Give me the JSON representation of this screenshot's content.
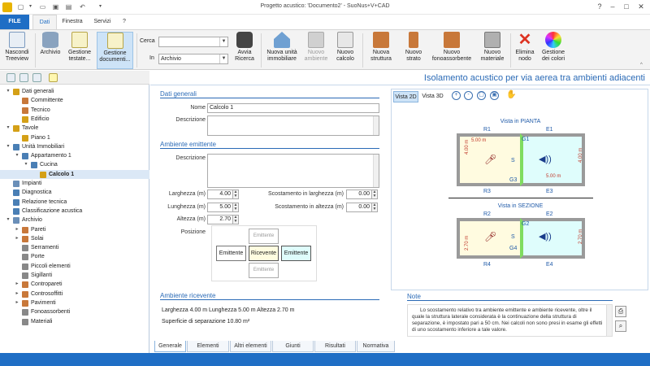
{
  "app": {
    "title": "Progetto acustico: 'Documento2' - SuoNus+V+CAD"
  },
  "tabs": {
    "file": "FILE",
    "items": [
      "Dati",
      "Finestra",
      "Servizi",
      "?"
    ]
  },
  "ribbon": {
    "nascondi": "Nascondi Treeview",
    "archivio": "Archivio",
    "gestione_testate": "Gestione testate...",
    "gestione_documenti": "Gestione documenti...",
    "cerca_label": "Cerca",
    "cerca_value": "",
    "in_label": "In",
    "in_value": "Archivio",
    "avvia": "Avvia Ricerca",
    "nuova_unita": "Nuova unità immobiliare",
    "nuovo_ambiente": "Nuovo ambiente",
    "nuovo_calcolo": "Nuovo calcolo",
    "nuova_struttura": "Nuova struttura",
    "nuovo_strato": "Nuovo strato",
    "nuovo_fono": "Nuovo fonoassorbente",
    "nuovo_materiale": "Nuovo materiale",
    "elimina_nodo": "Elimina nodo",
    "gestione_colori": "Gestione dei colori"
  },
  "tree": [
    {
      "label": "Dati generali",
      "level": 0,
      "exp": "▾",
      "icon": "folder-icon",
      "color": "#d4a017"
    },
    {
      "label": "Committente",
      "level": 1,
      "exp": "",
      "icon": "person-icon",
      "color": "#c8783a"
    },
    {
      "label": "Tecnico",
      "level": 1,
      "exp": "",
      "icon": "technician-icon",
      "color": "#c8783a"
    },
    {
      "label": "Edificio",
      "level": 1,
      "exp": "",
      "icon": "building-icon",
      "color": "#d4a017"
    },
    {
      "label": "Tavole",
      "level": 0,
      "exp": "▾",
      "icon": "folder-icon",
      "color": "#d4a017"
    },
    {
      "label": "Piano 1",
      "level": 1,
      "exp": "",
      "icon": "floor-icon",
      "color": "#d4a017"
    },
    {
      "label": "Unità Immobiliari",
      "level": 0,
      "exp": "▾",
      "icon": "home-icon",
      "color": "#4a7fb5"
    },
    {
      "label": "Appartamento 1",
      "level": 1,
      "exp": "▾",
      "icon": "home-icon",
      "color": "#4a7fb5"
    },
    {
      "label": "Cucina",
      "level": 2,
      "exp": "▾",
      "icon": "room-icon",
      "color": "#4a7fb5"
    },
    {
      "label": "Calcolo 1",
      "level": 3,
      "exp": "",
      "icon": "speaker-icon",
      "color": "#d4a017",
      "selected": true
    },
    {
      "label": "Impianti",
      "level": 0,
      "exp": "",
      "icon": "plant-icon",
      "color": "#6a8fb8"
    },
    {
      "label": "Diagnostica",
      "level": 0,
      "exp": "",
      "icon": "diagnostic-icon",
      "color": "#4a7fb5"
    },
    {
      "label": "Relazione tecnica",
      "level": 0,
      "exp": "",
      "icon": "report-icon",
      "color": "#4a7fb5"
    },
    {
      "label": "Classificazione acustica",
      "level": 0,
      "exp": "",
      "icon": "classification-icon",
      "color": "#4a7fb5"
    },
    {
      "label": "Archivio",
      "level": 0,
      "exp": "▾",
      "icon": "archive-icon",
      "color": "#6a8fb8"
    },
    {
      "label": "Pareti",
      "level": 1,
      "exp": "▸",
      "icon": "wall-icon",
      "color": "#c8783a"
    },
    {
      "label": "Solai",
      "level": 1,
      "exp": "▸",
      "icon": "slab-icon",
      "color": "#c8783a"
    },
    {
      "label": "Serramenti",
      "level": 1,
      "exp": "",
      "icon": "window-icon",
      "color": "#888"
    },
    {
      "label": "Porte",
      "level": 1,
      "exp": "",
      "icon": "door-icon",
      "color": "#888"
    },
    {
      "label": "Piccoli elementi",
      "level": 1,
      "exp": "",
      "icon": "element-icon",
      "color": "#888"
    },
    {
      "label": "Sigillanti",
      "level": 1,
      "exp": "",
      "icon": "sealant-icon",
      "color": "#888"
    },
    {
      "label": "Contropareti",
      "level": 1,
      "exp": "▸",
      "icon": "counterwall-icon",
      "color": "#c8783a"
    },
    {
      "label": "Controsoffitti",
      "level": 1,
      "exp": "▸",
      "icon": "ceiling-icon",
      "color": "#c8783a"
    },
    {
      "label": "Pavimenti",
      "level": 1,
      "exp": "▸",
      "icon": "floor-icon",
      "color": "#c8783a"
    },
    {
      "label": "Fonoassorbenti",
      "level": 1,
      "exp": "",
      "icon": "absorber-icon",
      "color": "#888"
    },
    {
      "label": "Materiali",
      "level": 1,
      "exp": "",
      "icon": "material-icon",
      "color": "#888"
    }
  ],
  "header": {
    "title": "Isolamento acustico per via aerea tra ambienti adiacenti"
  },
  "dati_generali": {
    "section": "Dati generali",
    "nome_label": "Nome",
    "nome_value": "Calcolo 1",
    "descrizione_label": "Descrizione"
  },
  "emittente": {
    "section": "Ambiente emittente",
    "descrizione_label": "Descrizione",
    "larghezza_label": "Larghezza (m)",
    "larghezza_value": "4.00",
    "lunghezza_label": "Lunghezza (m)",
    "lunghezza_value": "5.00",
    "altezza_label": "Altezza (m)",
    "altezza_value": "2.70",
    "scost_larg_label": "Scostamento in larghezza (m)",
    "scost_larg_value": "0.00",
    "scost_alt_label": "Scostamento in altezza (m)",
    "scost_alt_value": "0.00",
    "posizione_label": "Posizione",
    "pos_top": "Emittente",
    "pos_left": "Emittente",
    "pos_center": "Ricevente",
    "pos_right": "Emittente",
    "pos_bottom": "Emittente"
  },
  "ricevente": {
    "section": "Ambiente ricevente",
    "dims": "Larghezza 4.00 m   Lunghezza 5.00 m   Altezza 2.70 m",
    "superficie": "Superficie di separazione 10.80 m²"
  },
  "view": {
    "tab2d": "Vista 2D",
    "tab3d": "Vista 3D",
    "pianta": "Vista in PIANTA",
    "sezione": "Vista in SEZIONE",
    "r1": "R1",
    "e1": "E1",
    "r3": "R3",
    "e3": "E3",
    "g1": "G1",
    "g3": "G3",
    "s": "S",
    "r2": "R2",
    "e2": "E2",
    "r4": "R4",
    "e4": "E4",
    "g2": "G2",
    "g4": "G4",
    "dim_5": "5.00 m",
    "dim_4": "4.00 m",
    "dim_27": "2.70 m"
  },
  "note": {
    "section": "Note",
    "text": "Lo scostamento relativo tra ambiente emittente e ambiente ricevente, oltre il quale la struttura laterale considerata è la continuazione della struttura di separazione, è impostato pari a 50 cm. Nei calcoli non sono presi in esame gli effetti di uno scostamento inferiore a tale valore."
  },
  "bottom_tabs": [
    "Generale",
    "Elementi",
    "Altri elementi",
    "Giunti",
    "Risultati",
    "Normativa"
  ]
}
